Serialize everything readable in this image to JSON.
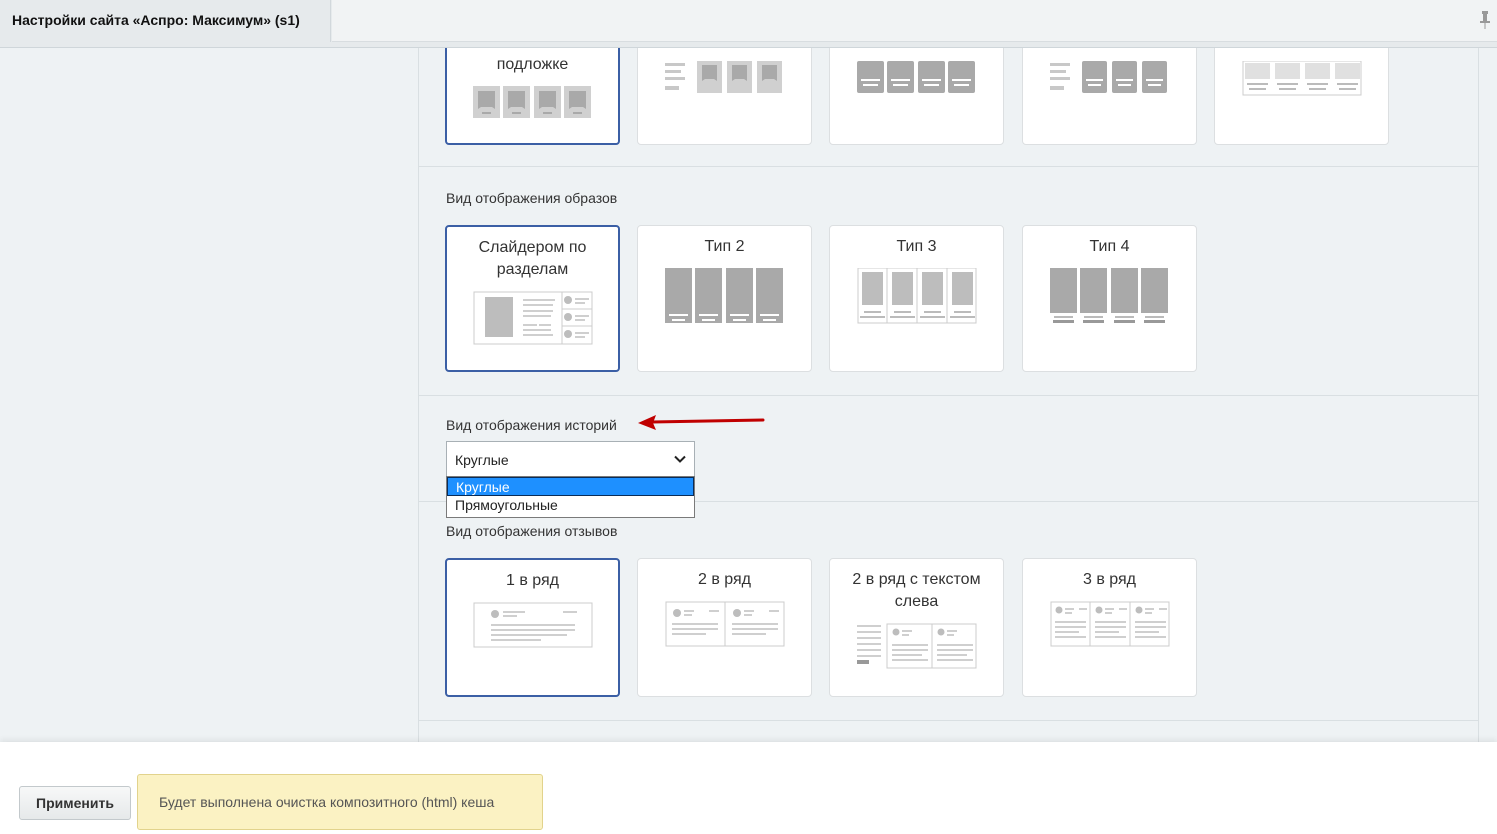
{
  "window": {
    "tab_title": "Настройки сайта «Аспро: Максимум» (s1)"
  },
  "sections": {
    "top_row": {
      "first_card_label": "подложке"
    },
    "images_view": {
      "label": "Вид отображения образов",
      "cards": [
        "Слайдером по разделам",
        "Тип 2",
        "Тип 3",
        "Тип 4"
      ]
    },
    "stories_view": {
      "label": "Вид отображения историй",
      "selected_value": "Круглые",
      "options": [
        "Круглые",
        "Прямоугольные"
      ]
    },
    "reviews_view": {
      "label": "Вид отображения отзывов",
      "cards": [
        "1 в ряд",
        "2 в ряд",
        "2 в ряд с текстом слева",
        "3 в ряд"
      ]
    }
  },
  "footer": {
    "apply_label": "Применить",
    "notice": "Будет выполнена очистка композитного (html) кеша"
  },
  "colors": {
    "selected_border": "#3b5fa5",
    "arrow": "#c00000",
    "notice_bg": "#fbf2c3",
    "option_highlight": "#1e90ff"
  }
}
